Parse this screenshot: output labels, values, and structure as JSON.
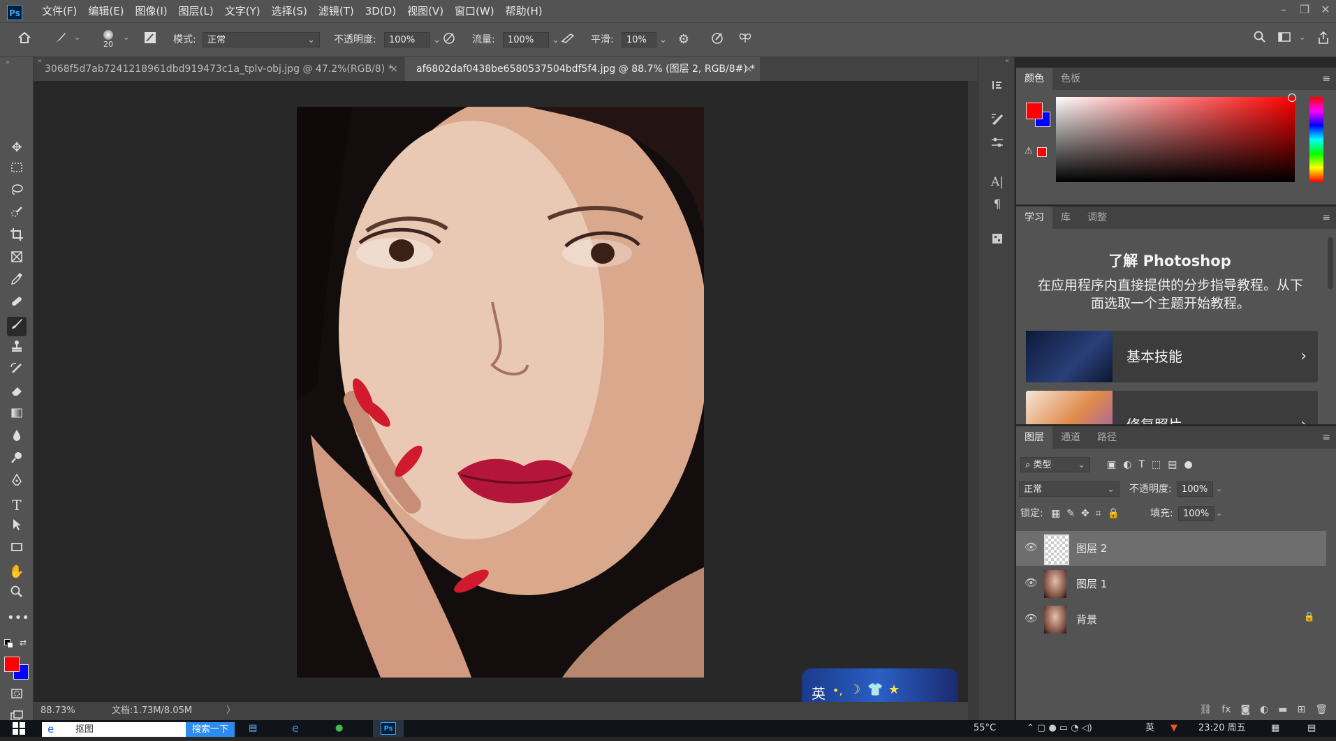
{
  "app": {
    "logo": "Ps"
  },
  "menu": [
    "文件(F)",
    "编辑(E)",
    "图像(I)",
    "图层(L)",
    "文字(Y)",
    "选择(S)",
    "滤镜(T)",
    "3D(D)",
    "视图(V)",
    "窗口(W)",
    "帮助(H)"
  ],
  "window_controls": {
    "minimize": "–",
    "restore": "❐",
    "close": "✕"
  },
  "options": {
    "brush_size": "20",
    "mode_label": "模式:",
    "mode_value": "正常",
    "opacity_label": "不透明度:",
    "opacity_value": "100%",
    "flow_label": "流量:",
    "flow_value": "100%",
    "smooth_label": "平滑:",
    "smooth_value": "10%"
  },
  "tabs": [
    {
      "label": "3068f5d7ab7241218961dbd919473c1a_tplv-obj.jpg @ 47.2%(RGB/8) *",
      "close": "×"
    },
    {
      "label": "af6802daf0438be6580537504bdf5f4.jpg  @ 88.7% (图层 2, RGB/8#) *",
      "close": "×"
    }
  ],
  "status": {
    "zoom": "88.73%",
    "doc": "文档:1.73M/8.05M",
    "arrow": "〉"
  },
  "colors": {
    "foreground": "#ff0000",
    "background": "#0000ff",
    "accent": "#31a8ff"
  },
  "color_panel": {
    "tabs": [
      "颜色",
      "色板"
    ]
  },
  "learn_panel": {
    "tabs": [
      "学习",
      "库",
      "调整"
    ],
    "title": "了解 Photoshop",
    "description": "在应用程序内直接提供的分步指导教程。从下面选取一个主题开始教程。",
    "cards": [
      {
        "label": "基本技能"
      },
      {
        "label": "修复照片"
      }
    ]
  },
  "layers_panel": {
    "tabs": [
      "图层",
      "通道",
      "路径"
    ],
    "filter_label": "类型",
    "blend_mode": "正常",
    "opacity_label": "不透明度:",
    "opacity_value": "100%",
    "lock_label": "锁定:",
    "fill_label": "填充:",
    "fill_value": "100%",
    "layers": [
      {
        "name": "图层 2"
      },
      {
        "name": "图层 1"
      },
      {
        "name": "背景"
      }
    ]
  },
  "ime": {
    "label": "英"
  },
  "taskbar": {
    "search_text": "抠图",
    "search_button": "搜索一下",
    "temperature": "55°C",
    "lang": "英",
    "clock": "23:20 周五"
  }
}
